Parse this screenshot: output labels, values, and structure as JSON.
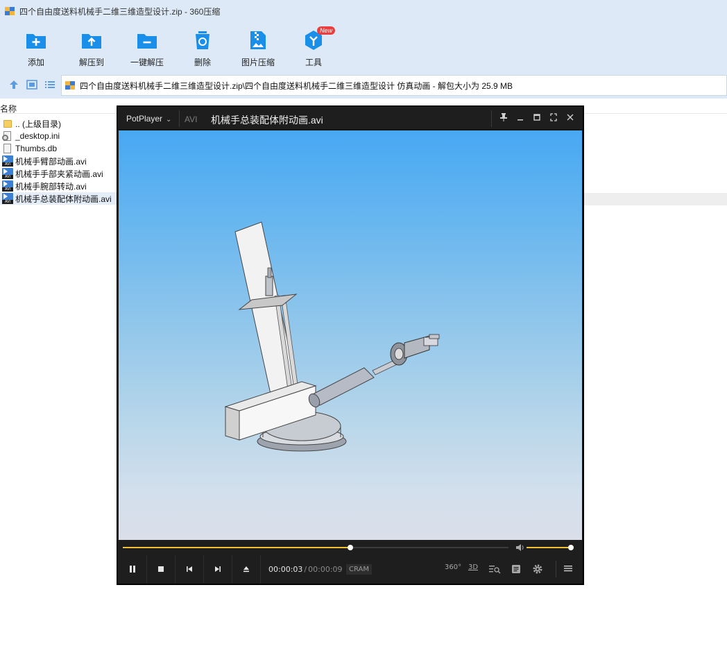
{
  "window": {
    "title": "四个自由度送料机械手二维三维造型设计.zip - 360压缩"
  },
  "toolbar": {
    "buttons": [
      {
        "label": "添加",
        "icon": "add-icon"
      },
      {
        "label": "解压到",
        "icon": "extract-to-icon"
      },
      {
        "label": "一键解压",
        "icon": "one-click-extract-icon"
      },
      {
        "label": "删除",
        "icon": "delete-icon"
      },
      {
        "label": "图片压缩",
        "icon": "image-compress-icon"
      },
      {
        "label": "工具",
        "icon": "tools-icon",
        "badge": "New"
      }
    ]
  },
  "address": {
    "path": "四个自由度送料机械手二维三维造型设计.zip\\四个自由度送料机械手二维三维造型设计 仿真动画 - 解包大小为 25.9 MB"
  },
  "filelist": {
    "column_header": "名称",
    "files": [
      {
        "name": ".. (上级目录)",
        "icon": "folder-icon"
      },
      {
        "name": "_desktop.ini",
        "icon": "ini-file-icon"
      },
      {
        "name": "Thumbs.db",
        "icon": "db-file-icon"
      },
      {
        "name": "机械手臂部动画.avi",
        "icon": "avi-file-icon"
      },
      {
        "name": "机械手手部夹紧动画.avi",
        "icon": "avi-file-icon"
      },
      {
        "name": "机械手腕部转动.avi",
        "icon": "avi-file-icon"
      },
      {
        "name": "机械手总装配体附动画.avi",
        "icon": "avi-file-icon",
        "selected": true
      }
    ],
    "avi_label": "AVI"
  },
  "player": {
    "brand": "PotPlayer",
    "format": "AVI",
    "file_title": "机械手总装配体附动画.avi",
    "current_time": "00:00:03",
    "total_time": "00:00:09",
    "codec": "CRAM",
    "progress": 0.59,
    "volume": 1.0,
    "right_controls": [
      "360°",
      "3D"
    ]
  }
}
